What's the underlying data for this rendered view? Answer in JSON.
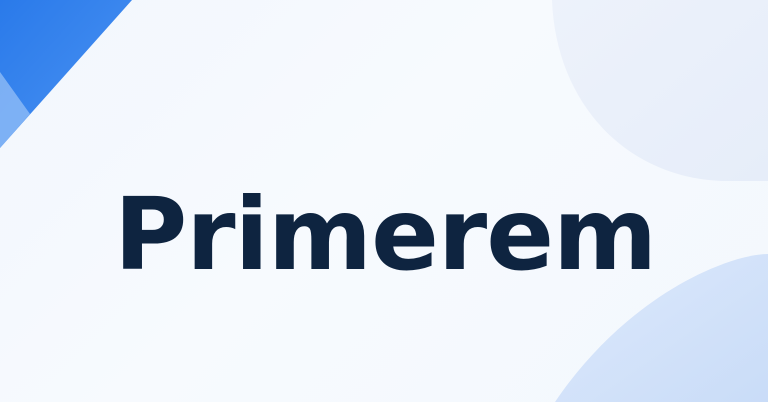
{
  "brand": {
    "wordmark": "Primerem"
  },
  "colors": {
    "background": "#f5f9fe",
    "wordmark": "#0e2440",
    "accent_dark": "#2f80ee",
    "accent_light": "#7fb0f5",
    "blob_soft": "#e7eefa",
    "blob_blue": "#d6e5fb"
  }
}
